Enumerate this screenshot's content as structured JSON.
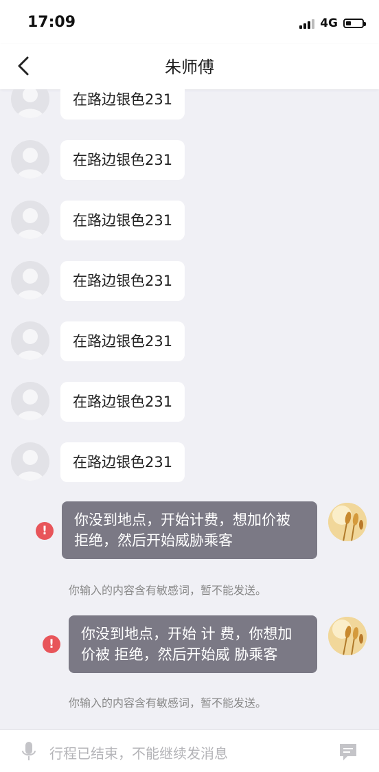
{
  "status_bar": {
    "time": "17:09",
    "network": "4G",
    "battery_level": 0.3
  },
  "header": {
    "title": "朱师傅",
    "back_icon": "chevron-left-icon"
  },
  "messages_received": [
    {
      "text": "在路边银色231"
    },
    {
      "text": "在路边银色231"
    },
    {
      "text": "在路边银色231"
    },
    {
      "text": "在路边银色231"
    },
    {
      "text": "在路边银色231"
    },
    {
      "text": "在路边银色231"
    },
    {
      "text": "在路边银色231"
    }
  ],
  "messages_sent": [
    {
      "line1": "你没到地点，开始计费，想加价被",
      "line2": "拒绝，然后开始威胁乘客",
      "error_icon": "!",
      "notice": "你输入的内容含有敏感词，暂不能发送。"
    },
    {
      "line1": "你没到地点，开始 计 费，你想加",
      "line2": "价被 拒绝，然后开始威 胁乘客",
      "error_icon": "!",
      "notice": "你输入的内容含有敏感词，暂不能发送。"
    }
  ],
  "input_bar": {
    "placeholder": "行程已结束，不能继续发消息",
    "left_icon": "microphone-icon",
    "right_icon": "message-icon"
  },
  "colors": {
    "background": "#f0f0f5",
    "sent_bubble": "#7b7985",
    "error": "#e8555a"
  }
}
